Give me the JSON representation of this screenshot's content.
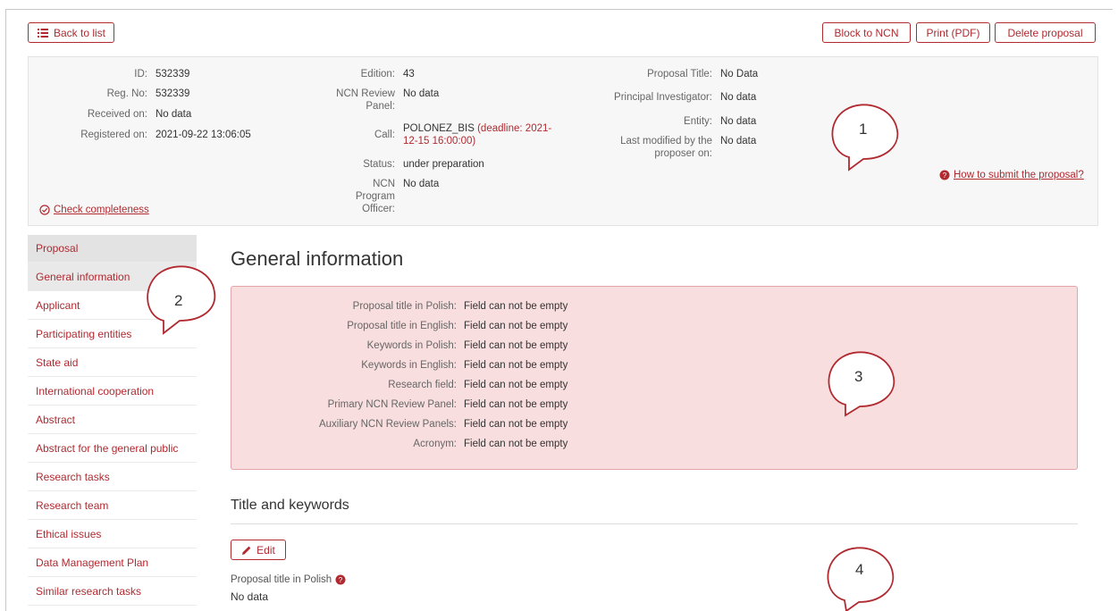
{
  "toolbar": {
    "back_label": "Back to list",
    "block_label": "Block to NCN",
    "print_label": "Print (PDF)",
    "delete_label": "Delete proposal"
  },
  "info": {
    "col1": [
      {
        "label": "ID:",
        "value": "532339"
      },
      {
        "label": "Reg. No:",
        "value": "532339"
      },
      {
        "label": "Received on:",
        "value": "No data"
      },
      {
        "label": "Registered on:",
        "value": "2021-09-22 13:06:05"
      }
    ],
    "col2": {
      "edition_label": "Edition:",
      "edition_value": "43",
      "panel_label_1": "NCN Review",
      "panel_label_2": "Panel:",
      "panel_value": "No data",
      "call_label": "Call:",
      "call_value": "POLONEZ_BIS",
      "call_deadline_1": "(deadline: 2021-",
      "call_deadline_2": "12-15 16:00:00)",
      "status_label": "Status:",
      "status_value": "under preparation",
      "officer_label_1": "NCN",
      "officer_label_2": "Program",
      "officer_label_3": "Officer:",
      "officer_value": "No data"
    },
    "col3": {
      "title_label": "Proposal Title:",
      "title_value": "No Data",
      "pi_label": "Principal Investigator:",
      "pi_value": "No data",
      "entity_label": "Entity:",
      "entity_value": "No data",
      "modified_label_1": "Last modified by the",
      "modified_label_2": "proposer on:",
      "modified_value": "No data"
    },
    "check_link": "Check completeness",
    "how_link": "How to submit the proposal?"
  },
  "sidebar": {
    "header": "Proposal",
    "items": [
      "General information",
      "Applicant",
      "Participating entities",
      "State aid",
      "International cooperation",
      "Abstract",
      "Abstract for the general public",
      "Research tasks",
      "Research team",
      "Ethical issues",
      "Data Management Plan",
      "Similar research tasks"
    ]
  },
  "main": {
    "heading": "General information",
    "errors": [
      {
        "label": "Proposal title in Polish:",
        "message": "Field can not be empty"
      },
      {
        "label": "Proposal title in English:",
        "message": "Field can not be empty"
      },
      {
        "label": "Keywords in Polish:",
        "message": "Field can not be empty"
      },
      {
        "label": "Keywords in English:",
        "message": "Field can not be empty"
      },
      {
        "label": "Research field:",
        "message": "Field can not be empty"
      },
      {
        "label": "Primary NCN Review Panel:",
        "message": "Field can not be empty"
      },
      {
        "label": "Auxiliary NCN Review Panels:",
        "message": "Field can not be empty"
      },
      {
        "label": "Acronym:",
        "message": "Field can not be empty"
      }
    ],
    "section_title": "Title and keywords",
    "edit_label": "Edit",
    "field_label": "Proposal title in Polish",
    "field_value": "No data"
  },
  "callouts": [
    "1",
    "2",
    "3",
    "4"
  ],
  "colors": {
    "accent": "#b02a30",
    "error_bg": "#f8dede",
    "error_border": "#e3a5a8",
    "panel_bg": "#f7f7f7"
  }
}
